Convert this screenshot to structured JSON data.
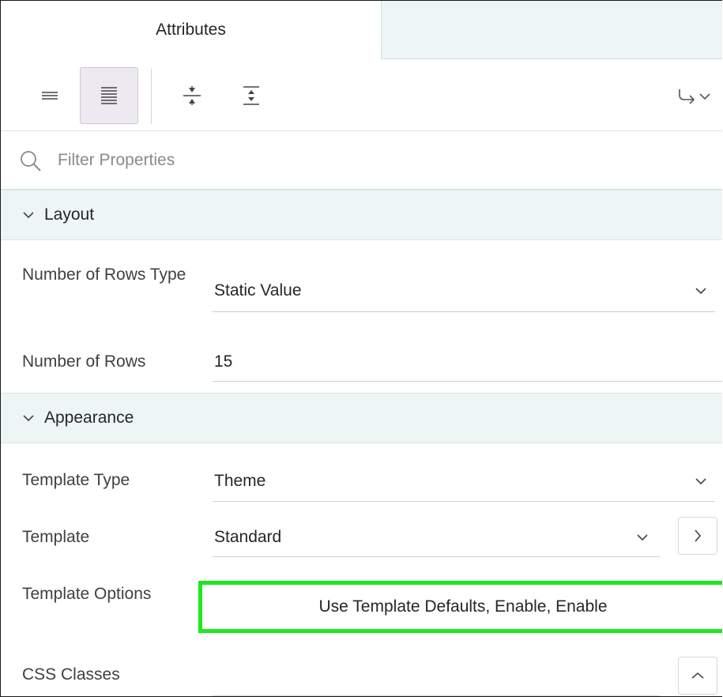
{
  "tabs": {
    "active_label": "Attributes"
  },
  "toolbar": {
    "buttons": [
      {
        "icon": "compact-view-icon",
        "selected": false
      },
      {
        "icon": "expanded-view-icon",
        "selected": true
      },
      {
        "icon": "collapse-all-icon",
        "selected": false
      },
      {
        "icon": "expand-all-icon",
        "selected": false
      },
      {
        "icon": "go-to-group-icon",
        "selected": false
      }
    ]
  },
  "filter": {
    "placeholder": "Filter Properties",
    "value": ""
  },
  "sections": {
    "layout": {
      "title": "Layout",
      "rows_type_label": "Number of Rows Type",
      "rows_type_value": "Static Value",
      "rows_label": "Number of Rows",
      "rows_value": "15"
    },
    "appearance": {
      "title": "Appearance",
      "template_type_label": "Template Type",
      "template_type_value": "Theme",
      "template_label": "Template",
      "template_value": "Standard",
      "template_options_label": "Template Options",
      "template_options_value": "Use Template Defaults, Enable, Enable",
      "css_classes_label": "CSS Classes",
      "css_classes_value": ""
    }
  },
  "colors": {
    "highlight": "#1bea1b",
    "section_bg": "#eef5f5",
    "selected_btn_bg": "#ede9f1"
  }
}
